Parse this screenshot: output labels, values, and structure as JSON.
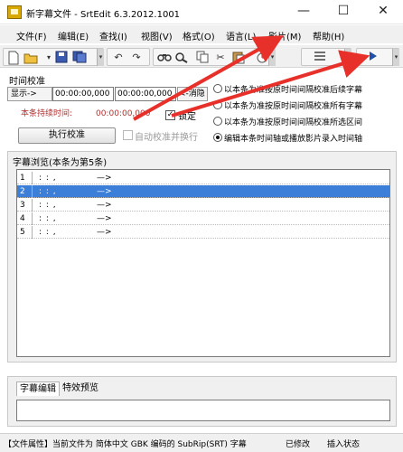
{
  "window": {
    "title": "新字幕文件 - SrtEdit 6.3.2012.1001",
    "minimize": "—",
    "maximize": "☐",
    "close": "✕"
  },
  "menu": {
    "items": [
      "文件(F)",
      "编辑(E)",
      "查找(I)",
      "视图(V)",
      "格式(O)",
      "语言(L)",
      "影片(M)",
      "帮助(H)"
    ]
  },
  "toolbar": {
    "icons": [
      "new-file-icon",
      "open-folder-icon",
      "save-icon",
      "save-all-icon",
      "undo-icon",
      "redo-icon",
      "find-icon",
      "find-next-icon",
      "cut-icon",
      "copy-icon",
      "paste-icon",
      "timing-icon",
      "list-view-icon",
      "play-icon"
    ]
  },
  "timing": {
    "section_label": "时间校准",
    "display_label": "显示->",
    "start_time": "00:00:00,000",
    "end_time": "00:00:00,000",
    "arrow_label": "<-消隐",
    "duration_label": "本条持续时间:",
    "duration_value": "00:00:00,000",
    "lock_label": "锁定",
    "lock_checked": true,
    "execute_button": "执行校准",
    "auto_label": "自动校准并换行",
    "auto_checked": false
  },
  "radios": [
    {
      "label": "以本条为准按原时间间隔校准后续字幕",
      "checked": false
    },
    {
      "label": "以本条为准按原时间间隔校准所有字幕",
      "checked": false
    },
    {
      "label": "以本条为准按原时间间隔校准所选区间",
      "checked": false
    },
    {
      "label": "编辑本条时间轴或播放影片录入时间轴",
      "checked": true
    }
  ],
  "browse": {
    "title": "字幕浏览(本条为第5条)",
    "rows": [
      {
        "num": "1",
        "time": ": : ,",
        "arrow": "—>",
        "selected": false
      },
      {
        "num": "2",
        "time": ": : ,",
        "arrow": "—>",
        "selected": true
      },
      {
        "num": "3",
        "time": ": : ,",
        "arrow": "—>",
        "selected": false
      },
      {
        "num": "4",
        "time": ": : ,",
        "arrow": "—>",
        "selected": false
      },
      {
        "num": "5",
        "time": ": : ,",
        "arrow": "—>",
        "selected": false
      }
    ]
  },
  "tabs": {
    "items": [
      "字幕编辑",
      "特效预览"
    ],
    "active": 0
  },
  "status": {
    "file_info": "【文件属性】当前文件为 简体中文 GBK 编码的 SubRip(SRT) 字幕",
    "modified": "已修改",
    "insert_mode": "插入状态"
  },
  "colors": {
    "selection": "#3c7fd8",
    "annotation_arrow": "#e8302a"
  }
}
